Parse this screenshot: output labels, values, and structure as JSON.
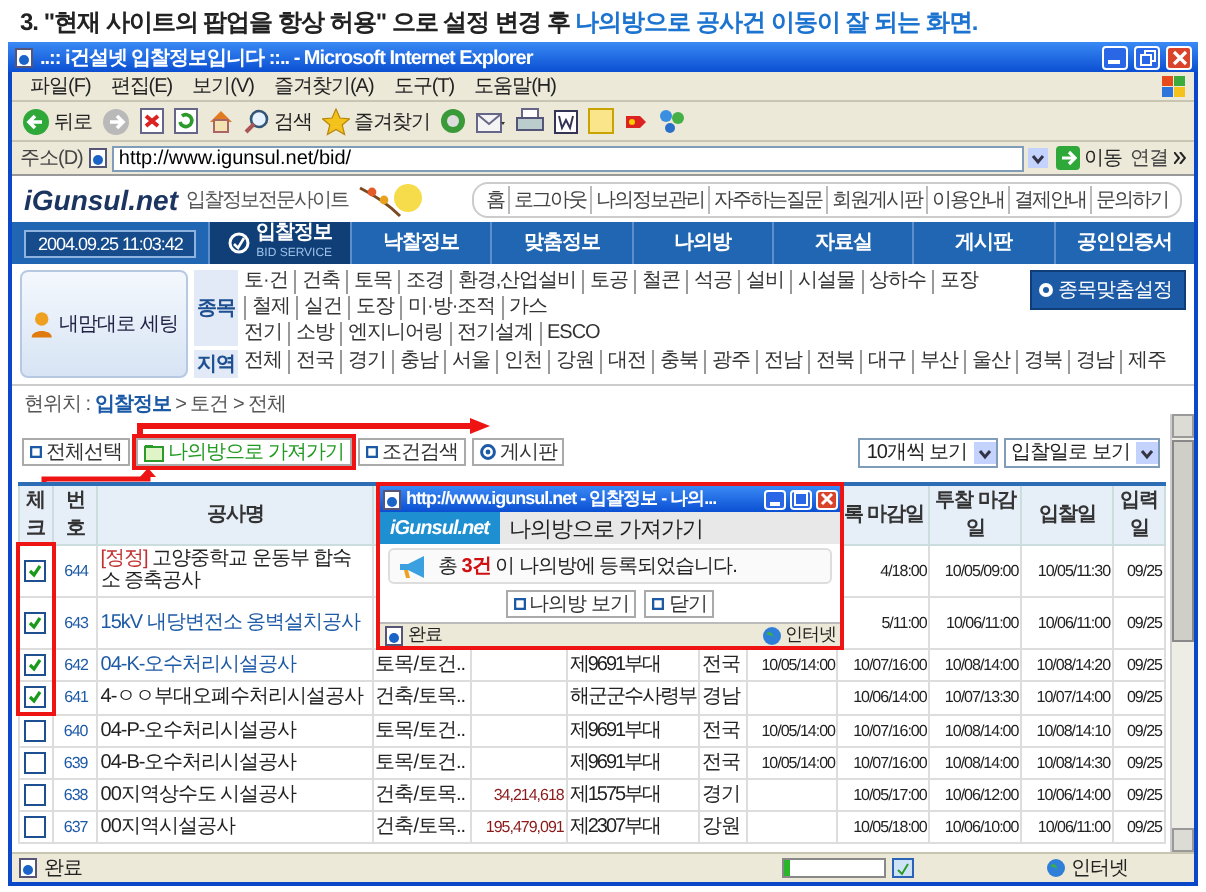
{
  "caption": {
    "text": "3. \"현재 사이트의 팝업을 항상 허용\" 으로 설정 변경 후 ",
    "highlight": "나의방으로 공사건 이동이 잘 되는 화면."
  },
  "browser": {
    "title": "..:: i건설넷 입찰정보입니다 ::.. - Microsoft Internet Explorer",
    "menu": [
      "파일(F)",
      "편집(E)",
      "보기(V)",
      "즐겨찾기(A)",
      "도구(T)",
      "도움말(H)"
    ],
    "toolbar": [
      {
        "kind": "back",
        "label": "뒤로"
      },
      {
        "kind": "forward"
      },
      {
        "kind": "stop"
      },
      {
        "kind": "refresh"
      },
      {
        "kind": "home"
      },
      {
        "kind": "search",
        "label": "검색"
      },
      {
        "kind": "favorites",
        "label": "즐겨찾기"
      },
      {
        "kind": "media"
      },
      {
        "kind": "mail"
      },
      {
        "kind": "print"
      },
      {
        "kind": "word"
      },
      {
        "kind": "note"
      },
      {
        "kind": "flag"
      },
      {
        "kind": "messenger"
      }
    ],
    "address_label": "주소(D)",
    "url": "http://www.igunsul.net/bid/",
    "go": "이동",
    "links": "연결",
    "status": "완료",
    "progress": {
      "level": 0.06
    },
    "zone": "인터넷"
  },
  "site": {
    "logo": "iGunsul.net",
    "tagline": "입찰정보전문사이트",
    "top_links": [
      "홈",
      "로그아웃",
      "나의정보관리",
      "자주하는질문",
      "회원게시판",
      "이용안내",
      "결제안내",
      "문의하기"
    ],
    "clock": "2004.09.25 11:03:42",
    "tabs": [
      {
        "label": "입찰정보",
        "sub": "BID SERVICE",
        "selected": true
      },
      {
        "label": "낙찰정보",
        "selected": false
      },
      {
        "label": "맞춤정보",
        "selected": false
      },
      {
        "label": "나의방",
        "selected": false
      },
      {
        "label": "자료실",
        "selected": false
      },
      {
        "label": "게시판",
        "selected": false
      },
      {
        "label": "공인인증서",
        "selected": false
      }
    ],
    "setup_button": "내맘대로 세팅",
    "trade_label": "종목",
    "trades": [
      "토·건",
      "건축",
      "토목",
      "조경",
      "환경,산업설비",
      "토공",
      "철콘",
      "석공",
      "설비",
      "시설물",
      "상하수",
      "포장",
      "철제",
      "실건",
      "도장",
      "미·방·조적",
      "가스"
    ],
    "trades_2": [
      "전기",
      "소방",
      "엔지니어링",
      "전기설계",
      "ESCO"
    ],
    "region_label": "지역",
    "regions": [
      "전체",
      "전국",
      "경기",
      "충남",
      "서울",
      "인천",
      "강원",
      "대전",
      "충북",
      "광주",
      "전남",
      "전북",
      "대구",
      "부산",
      "울산",
      "경북",
      "경남",
      "제주"
    ],
    "custom_button": "종목맞춤설정"
  },
  "breadcrumb": "현위치 : **입찰정보** > 토건 > 전체",
  "actions": [
    {
      "kind": "square",
      "label": "전체선택",
      "highlighted": false
    },
    {
      "kind": "folder",
      "label": "나의방으로 가져가기",
      "highlighted": true
    },
    {
      "kind": "square",
      "label": "조건검색",
      "highlighted": false
    },
    {
      "kind": "circle",
      "label": "게시판",
      "highlighted": false
    }
  ],
  "view_selects": [
    "10개씩 보기",
    "입찰일로 보기"
  ],
  "table": {
    "header": {
      "check": "체크",
      "number": "번호",
      "name": "공사명",
      "column_9": "록 마감일",
      "column_10": "투찰 마감일",
      "column_11": "입찰일",
      "column_12": "입력일"
    },
    "rows": [
      {
        "checked": true,
        "highlighted": true,
        "number": "644",
        "tag": "[정정]",
        "name": "고양중학교 운동부 합숙소 증축공사",
        "kind": "plain",
        "column_9": "4/18:00",
        "column_10": "10/05/09:00",
        "column_11": "10/05/11:30",
        "column_12": "09/25"
      },
      {
        "checked": true,
        "highlighted": true,
        "number": "643",
        "name": "15kV 내당변전소 옹벽설치공사",
        "kind": "link",
        "column_9": "5/11:00",
        "column_10": "10/06/11:00",
        "column_11": "10/06/11:00",
        "column_12": "09/25"
      },
      {
        "checked": true,
        "highlighted": true,
        "number": "642",
        "name": "04-K-오수처리시설공사",
        "kind": "link",
        "column_4": "토목/토건..",
        "column_6": "제9691부대",
        "column_7": "전국",
        "column_8": "10/05/14:00",
        "column_9": "10/07/16:00",
        "column_10": "10/08/14:00",
        "column_11": "10/08/14:20",
        "column_12": "09/25"
      },
      {
        "checked": true,
        "highlighted": true,
        "number": "641",
        "name": "4-ㅇㅇ부대오폐수처리시설공사",
        "kind": "plain",
        "column_4": "건축/토목..",
        "column_6": "해군군수사령부",
        "column_7": "경남",
        "column_9": "10/06/14:00",
        "column_10": "10/07/13:30",
        "column_11": "10/07/14:00",
        "column_12": "09/25"
      },
      {
        "checked": false,
        "highlighted": false,
        "number": "640",
        "name": "04-P-오수처리시설공사",
        "kind": "plain",
        "column_4": "토목/토건..",
        "column_6": "제9691부대",
        "column_7": "전국",
        "column_8": "10/05/14:00",
        "column_9": "10/07/16:00",
        "column_10": "10/08/14:00",
        "column_11": "10/08/14:10",
        "column_12": "09/25"
      },
      {
        "checked": false,
        "highlighted": false,
        "number": "639",
        "name": "04-B-오수처리시설공사",
        "kind": "plain",
        "column_4": "토목/토건..",
        "column_6": "제9691부대",
        "column_7": "전국",
        "column_8": "10/05/14:00",
        "column_9": "10/07/16:00",
        "column_10": "10/08/14:00",
        "column_11": "10/08/14:30",
        "column_12": "09/25"
      },
      {
        "checked": false,
        "highlighted": false,
        "number": "638",
        "name": "00지역상수도 시설공사",
        "kind": "plain",
        "column_4": "건축/토목..",
        "column_5": "34,214,618",
        "column_6": "제1575부대",
        "column_7": "경기",
        "column_9": "10/05/17:00",
        "column_10": "10/06/12:00",
        "column_11": "10/06/14:00",
        "column_12": "09/25"
      },
      {
        "checked": false,
        "highlighted": false,
        "number": "637",
        "name": "00지역시설공사",
        "kind": "plain",
        "column_4": "건축/토목..",
        "column_5": "195,479,091",
        "column_6": "제2307부대",
        "column_7": "강원",
        "column_9": "10/05/18:00",
        "column_10": "10/06/10:00",
        "column_11": "10/06/11:00",
        "column_12": "09/25"
      }
    ]
  },
  "popup": {
    "highlighted": true,
    "title": "http://www.igunsul.net - 입찰정보 - 나의...",
    "logo": "iGunsul.net",
    "heading": "나의방으로 가져가기",
    "message": "총 **3건** 이 나의방에 등록되었습니다.",
    "buttons": [
      {
        "kind": "square",
        "label": "나의방 보기"
      },
      {
        "kind": "square",
        "label": "닫기"
      }
    ],
    "status": "완료",
    "zone": "인터넷"
  }
}
